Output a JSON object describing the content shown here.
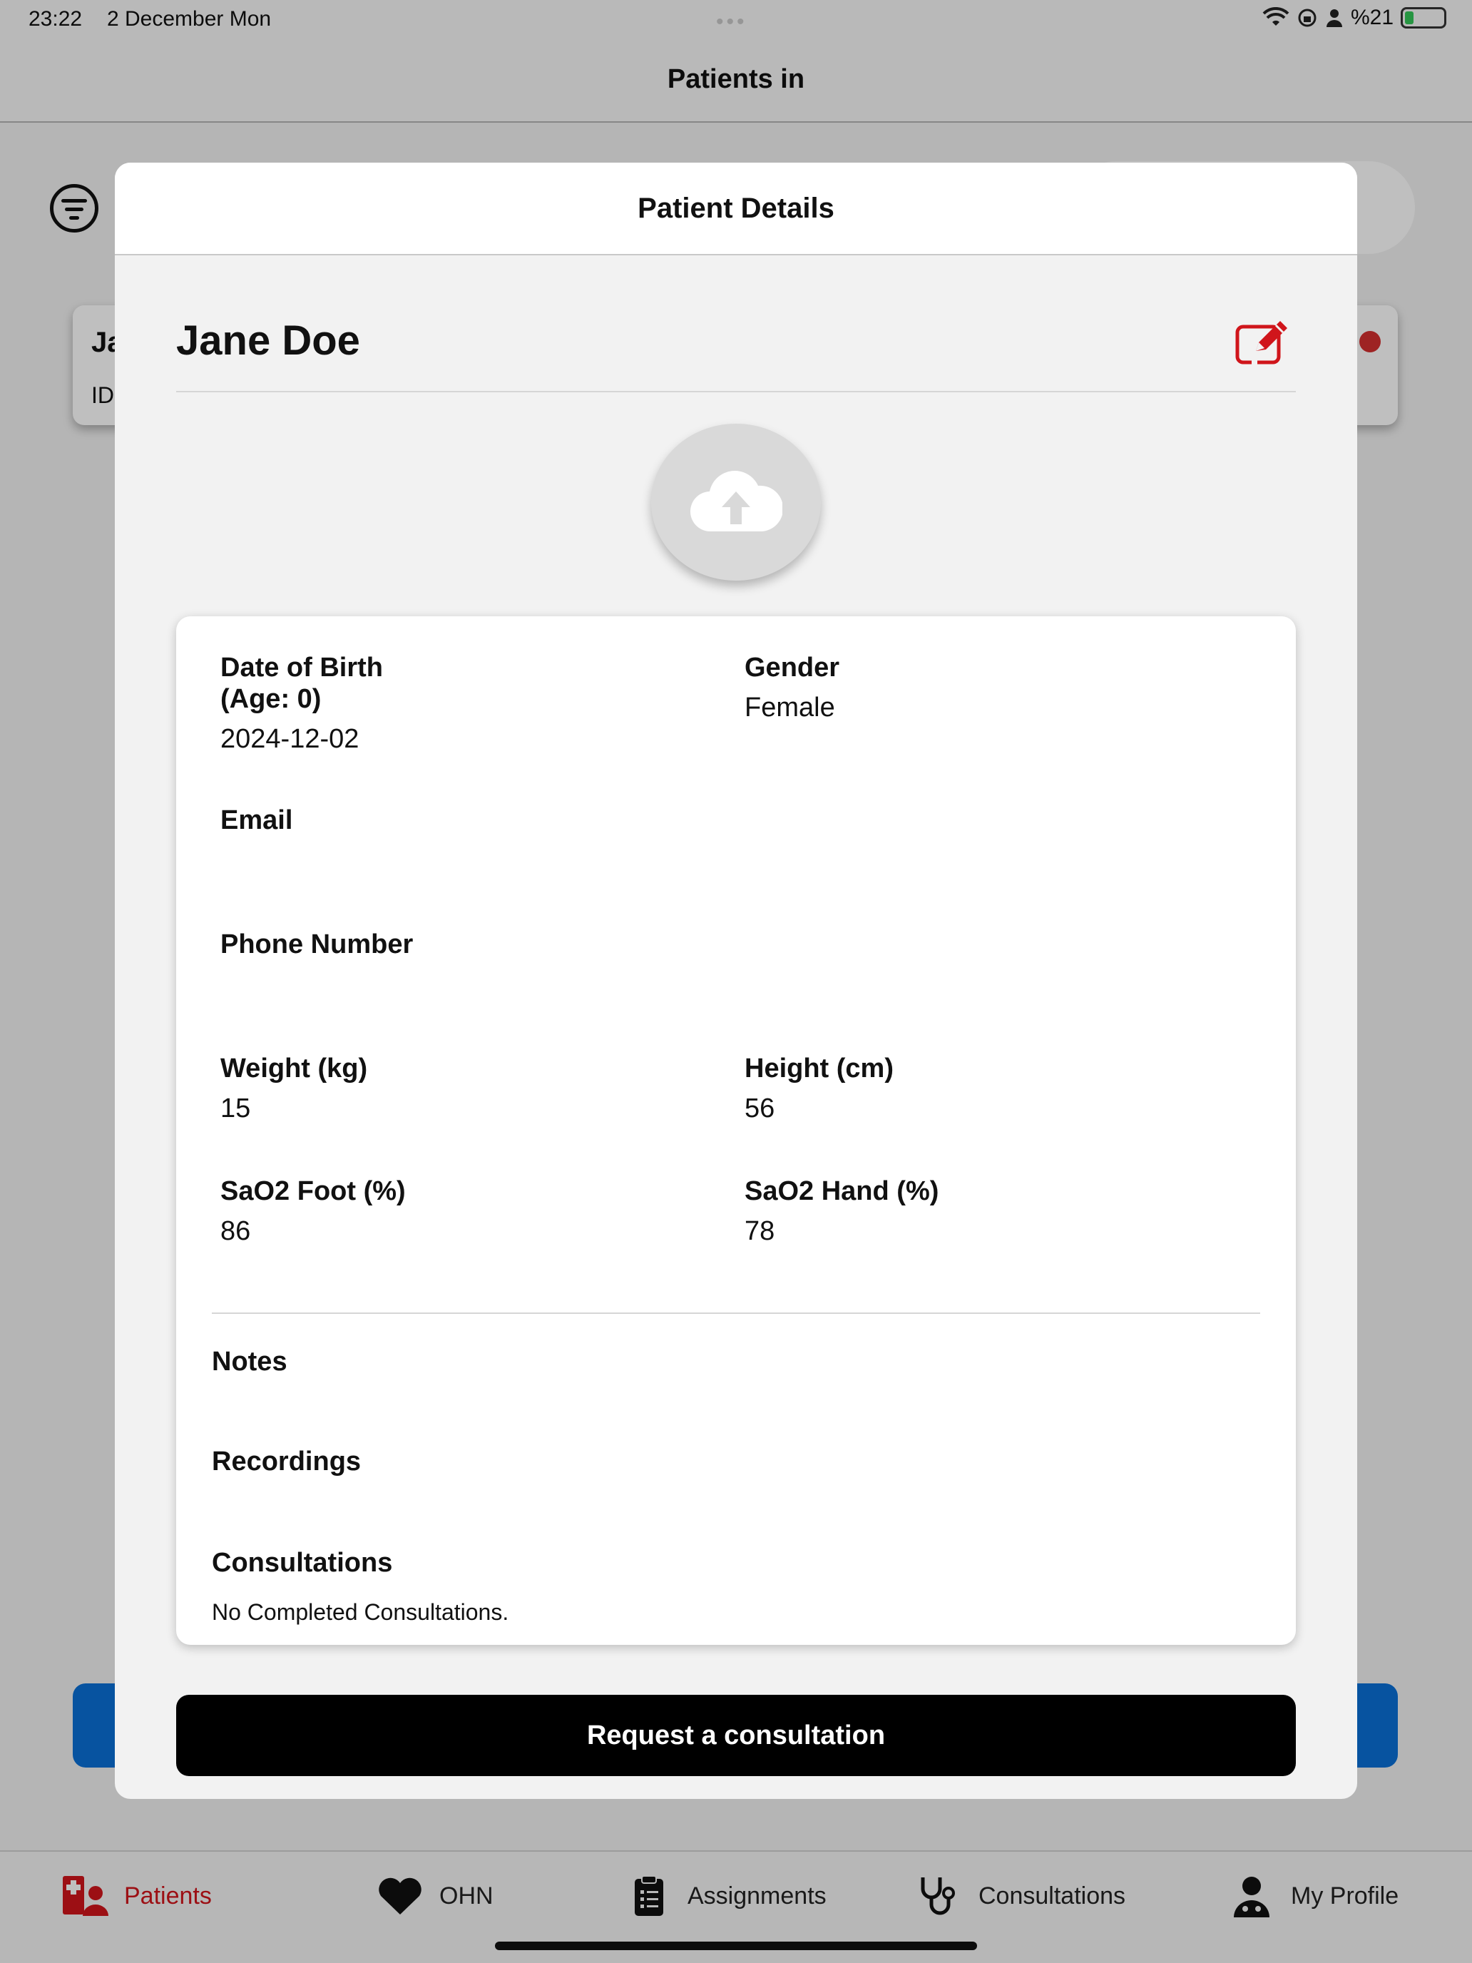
{
  "status_bar": {
    "time": "23:22",
    "date": "2 December Mon",
    "battery": "%21"
  },
  "nav": {
    "title": "Patients in"
  },
  "background_card": {
    "name_fragment": "Ja",
    "id_fragment": "ID"
  },
  "modal": {
    "title": "Patient Details",
    "patient_name": "Jane Doe",
    "fields": {
      "dob_label": "Date of Birth",
      "age_label": "(Age: 0)",
      "dob_value": "2024-12-02",
      "gender_label": "Gender",
      "gender_value": "Female",
      "email_label": "Email",
      "email_value": "",
      "phone_label": "Phone Number",
      "phone_value": "",
      "weight_label": "Weight (kg)",
      "weight_value": "15",
      "height_label": "Height (cm)",
      "height_value": "56",
      "sao2_foot_label": "SaO2 Foot (%)",
      "sao2_foot_value": "86",
      "sao2_hand_label": "SaO2 Hand (%)",
      "sao2_hand_value": "78"
    },
    "sections": {
      "notes_label": "Notes",
      "recordings_label": "Recordings",
      "consultations_label": "Consultations",
      "consultations_empty": "No Completed Consultations."
    },
    "request_button": "Request a consultation"
  },
  "tabbar": {
    "items": [
      {
        "label": "Patients",
        "icon": "patients-icon",
        "active": true
      },
      {
        "label": "OHN",
        "icon": "heart-icon",
        "active": false
      },
      {
        "label": "Assignments",
        "icon": "clipboard-icon",
        "active": false
      },
      {
        "label": "Consultations",
        "icon": "stethoscope-icon",
        "active": false
      },
      {
        "label": "My Profile",
        "icon": "doctor-icon",
        "active": false
      }
    ]
  },
  "colors": {
    "accent_red": "#d0151b",
    "primary_blue": "#0a6fd6",
    "button_black": "#000000"
  }
}
